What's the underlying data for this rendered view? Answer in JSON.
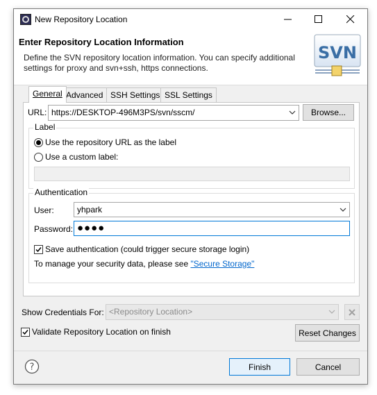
{
  "window": {
    "title": "New Repository Location"
  },
  "header": {
    "title": "Enter Repository Location Information",
    "description": "Define the SVN repository location information. You can specify additional settings for proxy and svn+ssh, https connections.",
    "logo_text": "SVN"
  },
  "tabs": [
    {
      "label": "General",
      "active": true
    },
    {
      "label": "Advanced",
      "active": false
    },
    {
      "label": "SSH Settings",
      "active": false
    },
    {
      "label": "SSL Settings",
      "active": false
    }
  ],
  "general": {
    "url_label": "URL:",
    "url_value": "https://DESKTOP-496M3PS/svn/sscm/",
    "browse_button": "Browse...",
    "label_group": {
      "legend": "Label",
      "option_repo_url": "Use the repository URL as the label",
      "option_custom": "Use a custom label:",
      "selected": "repository-url",
      "custom_value": ""
    },
    "auth_group": {
      "legend": "Authentication",
      "user_label": "User:",
      "user_value": "yhpark",
      "password_label": "Password:",
      "password_mask": "●●●●",
      "save_auth_label": "Save authentication (could trigger secure storage login)",
      "save_auth_checked": true,
      "security_note": "To manage your security data, please see ",
      "secure_storage_link": "\"Secure Storage\""
    }
  },
  "credentials": {
    "label": "Show Credentials For:",
    "value": "<Repository Location>"
  },
  "validate": {
    "label": "Validate Repository Location on finish",
    "checked": true
  },
  "buttons": {
    "reset": "Reset Changes",
    "finish": "Finish",
    "cancel": "Cancel"
  },
  "colors": {
    "accent": "#0078d7",
    "link": "#0066cc",
    "dialog_bg": "#f0f0f0",
    "svn_logo_blue": "#3a6ea5"
  }
}
